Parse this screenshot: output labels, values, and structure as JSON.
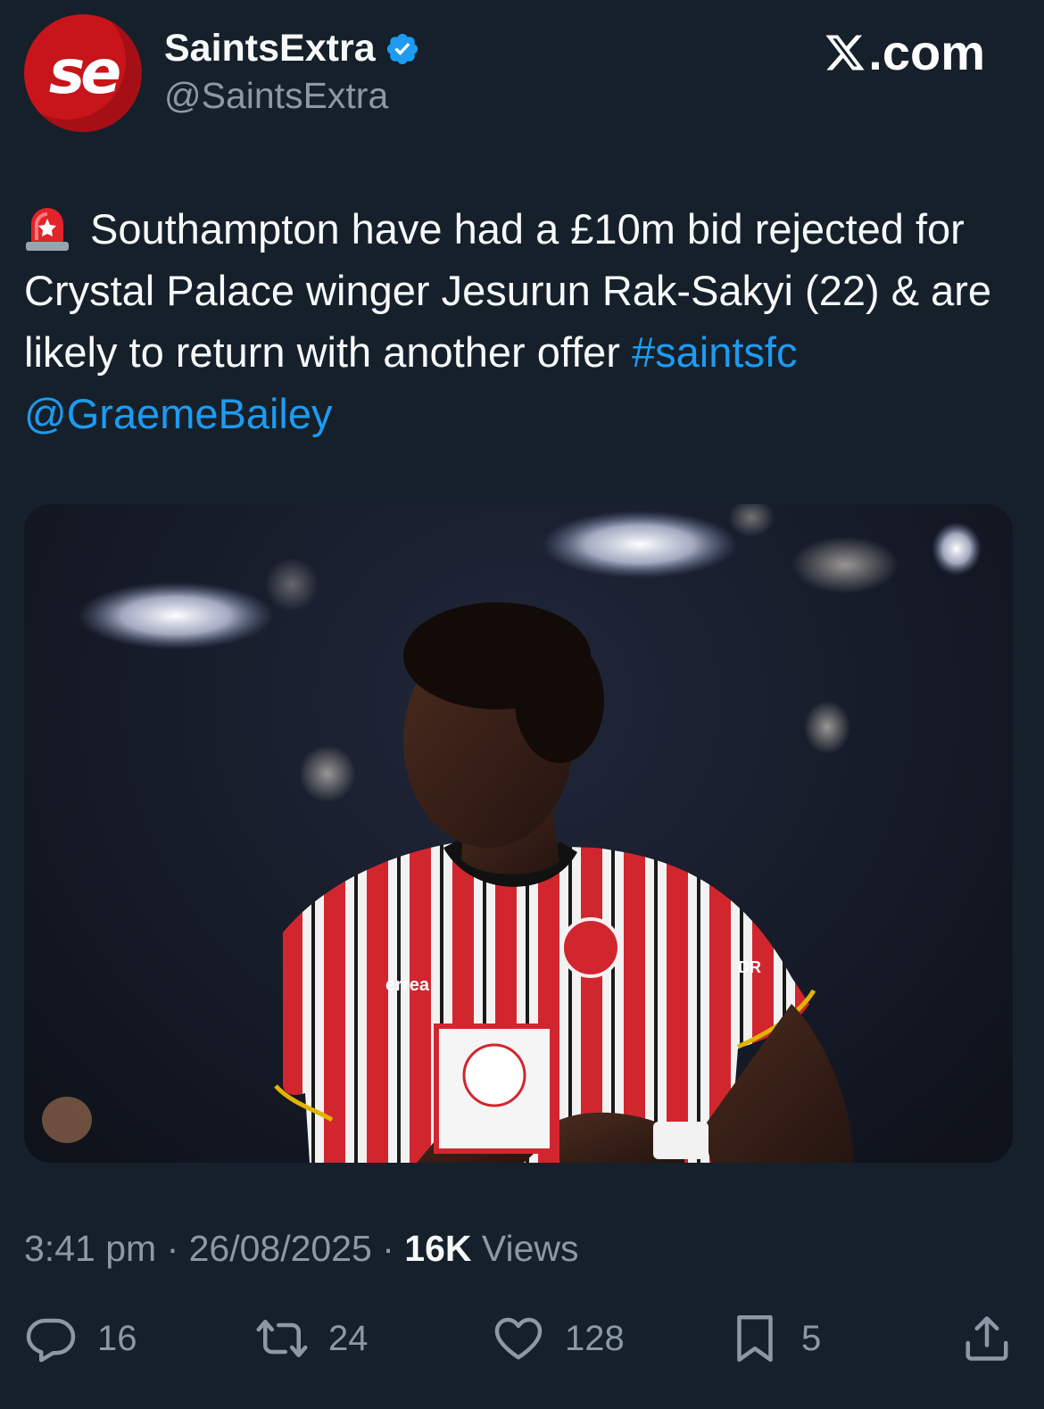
{
  "author": {
    "avatar_text": "se",
    "display_name": "SaintsExtra",
    "handle": "@SaintsExtra",
    "verified": true
  },
  "source_label": ".com",
  "tweet": {
    "emoji": "rotating-light",
    "text": "Southampton have had a £10m bid rejected for Crystal Palace winger Jesurun Rak-Sakyi (22) & are likely to return with another offer ",
    "hashtag": "#saintsfc",
    "mention": "@GraemeBailey"
  },
  "media": {
    "jersey_brand": "errea",
    "sleeve_sponsor": "DR"
  },
  "meta": {
    "time": "3:41 pm",
    "date": "26/08/2025",
    "views_count": "16K",
    "views_label": "Views"
  },
  "actions": {
    "replies": "16",
    "reposts": "24",
    "likes": "128",
    "bookmarks": "5"
  },
  "colors": {
    "background": "#15202b",
    "link": "#1d9bf0",
    "secondary_text": "#8b98a5",
    "verified_badge": "#1d9bf0"
  }
}
